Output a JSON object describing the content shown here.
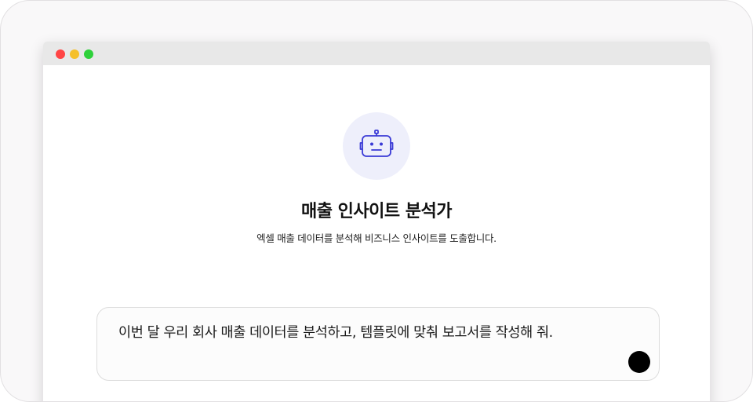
{
  "window": {
    "controls": {
      "close_color": "#ff4545",
      "minimize_color": "#f5c02b",
      "maximize_color": "#2fd13b"
    }
  },
  "assistant": {
    "icon": "robot-icon",
    "accent_color": "#3a3ad6",
    "title": "매출 인사이트 분석가",
    "description": "엑셀 매출 데이터를 분석해 비즈니스 인사이트를 도출합니다."
  },
  "prompt": {
    "value": "이번 달 우리 회사 매출 데이터를 분석하고, 템플릿에 맞춰 보고서를 작성해 줘.",
    "send_icon": "send-icon"
  }
}
